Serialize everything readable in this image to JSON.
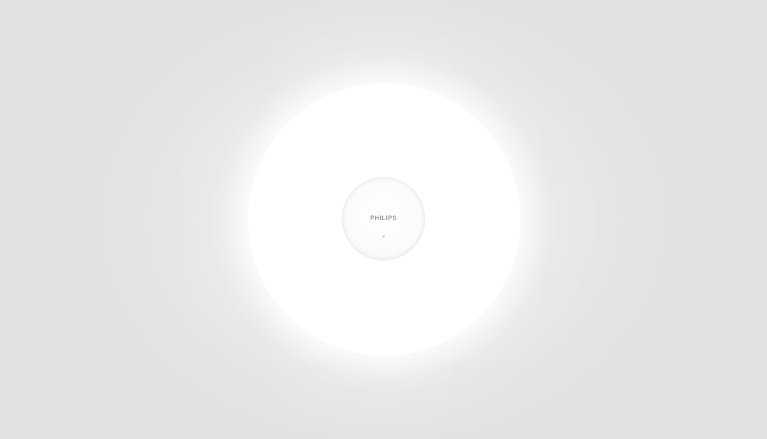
{
  "lamp": {
    "brand": "PHILIPS",
    "colors": {
      "background": "#e2e2e2",
      "disc": "#ffffff",
      "logo": "#9a9a9a"
    }
  }
}
